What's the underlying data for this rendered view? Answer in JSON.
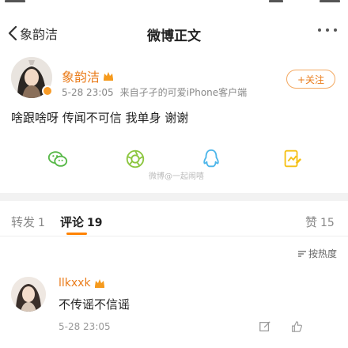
{
  "nav": {
    "back_label": "象韵洁",
    "title": "微博正文"
  },
  "post": {
    "author": "象韵洁",
    "time": "5-28 23:05",
    "source": "来自孑孑的可爱iPhone客户端",
    "follow_label": "+关注",
    "text": "啥跟啥呀 传闻不可信 我单身 谢谢"
  },
  "share": {
    "items": [
      "wechat-icon",
      "moments-icon",
      "qq-icon",
      "qzone-icon"
    ],
    "watermark": "微博@一起闹嘻"
  },
  "tabs": {
    "repost": {
      "label": "转发",
      "count": "1"
    },
    "comment": {
      "label": "评论",
      "count": "19"
    },
    "like": {
      "label": "赞",
      "count": "15"
    }
  },
  "sort": {
    "label": "按热度"
  },
  "comments": [
    {
      "name": "llkxxk",
      "text": "不传谣不信谣",
      "time": "5-28 23:05"
    }
  ],
  "colors": {
    "brand_orange": "#ea7c1b",
    "accent": "#ff8200",
    "wechat": "#57b848",
    "moments": "#8cc63f",
    "qq": "#4db6ea",
    "qzone": "#f5c117"
  }
}
